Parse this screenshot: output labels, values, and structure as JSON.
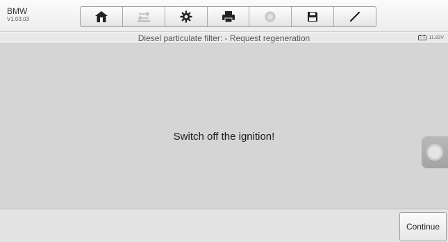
{
  "header": {
    "brand": "BMW",
    "version": "V1.03.03"
  },
  "toolbar": {
    "buttons": [
      {
        "icon": "home-icon",
        "enabled": true
      },
      {
        "icon": "vehicle-swap-icon",
        "enabled": false
      },
      {
        "icon": "gear-icon",
        "enabled": true
      },
      {
        "icon": "printer-icon",
        "enabled": true
      },
      {
        "icon": "help-icon",
        "enabled": false
      },
      {
        "icon": "save-icon",
        "enabled": true
      },
      {
        "icon": "pen-icon",
        "enabled": true
      }
    ]
  },
  "titlebar": {
    "title": "Diesel particulate filter: - Request regeneration",
    "battery_voltage": "11.83V"
  },
  "main": {
    "message": "Switch off the ignition!"
  },
  "footer": {
    "continue_label": "Continue"
  },
  "colors": {
    "icon_active": "#222222",
    "icon_disabled": "#b8b8b8",
    "content_bg": "#d5d5d5"
  }
}
